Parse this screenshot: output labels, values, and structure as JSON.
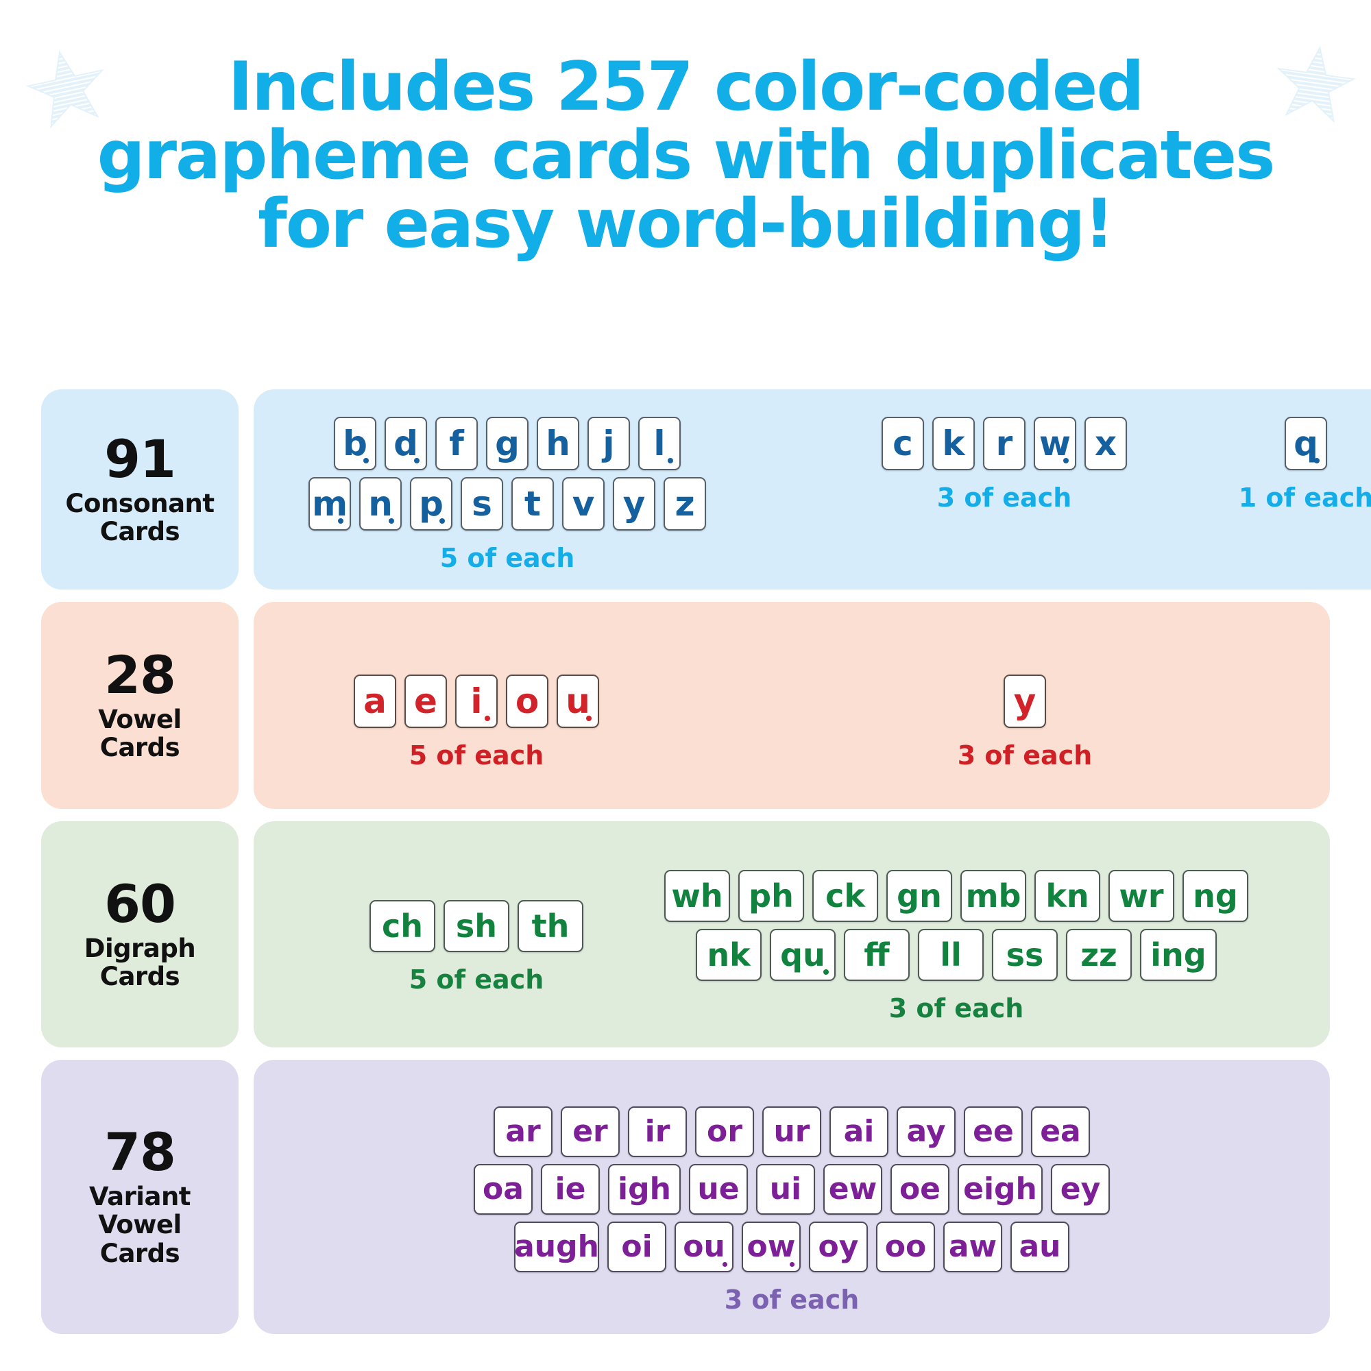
{
  "title": {
    "lines": [
      "Includes 257 color-coded",
      "grapheme cards with duplicates",
      "for easy word-building!"
    ],
    "color": "#11AEE8"
  },
  "decor": {
    "star_left": "star-icon",
    "star_right": "star-icon",
    "star_color": "#cde7f7"
  },
  "sections": [
    {
      "id": "consonant",
      "count": "91",
      "label_line1": "Consonant",
      "label_line2": "Cards",
      "panel_color": "#d6ecfa",
      "text_color": "#15609e",
      "count_label_color": "#15ade8",
      "groups": [
        {
          "id": "five",
          "count_label": "5 of each",
          "lines": [
            [
              {
                "t": "b",
                "dot": true
              },
              {
                "t": "d",
                "dot": true
              },
              {
                "t": "f",
                "dot": false
              },
              {
                "t": "g",
                "dot": false
              },
              {
                "t": "h",
                "dot": false
              },
              {
                "t": "j",
                "dot": false
              },
              {
                "t": "l",
                "dot": true
              }
            ],
            [
              {
                "t": "m",
                "dot": true
              },
              {
                "t": "n",
                "dot": true
              },
              {
                "t": "p",
                "dot": true
              },
              {
                "t": "s",
                "dot": false
              },
              {
                "t": "t",
                "dot": false
              },
              {
                "t": "v",
                "dot": false
              },
              {
                "t": "y",
                "dot": false
              },
              {
                "t": "z",
                "dot": false
              }
            ]
          ]
        },
        {
          "id": "three",
          "count_label": "3 of each",
          "lines": [
            [
              {
                "t": "c",
                "dot": false
              },
              {
                "t": "k",
                "dot": false
              },
              {
                "t": "r",
                "dot": false
              },
              {
                "t": "w",
                "dot": true
              },
              {
                "t": "x",
                "dot": false
              }
            ]
          ]
        },
        {
          "id": "one",
          "count_label": "1 of each",
          "lines": [
            [
              {
                "t": "q",
                "dot": true
              }
            ]
          ]
        }
      ]
    },
    {
      "id": "vowel",
      "count": "28",
      "label_line1": "Vowel",
      "label_line2": "Cards",
      "panel_color": "#fadfd2",
      "text_color": "#d2232a",
      "count_label_color": "#cf2026",
      "groups": [
        {
          "id": "five",
          "count_label": "5 of each",
          "lines": [
            [
              {
                "t": "a",
                "dot": false
              },
              {
                "t": "e",
                "dot": false
              },
              {
                "t": "i",
                "dot": true
              },
              {
                "t": "o",
                "dot": false
              },
              {
                "t": "u",
                "dot": true
              }
            ]
          ]
        },
        {
          "id": "three",
          "count_label": "3 of each",
          "lines": [
            [
              {
                "t": "y",
                "dot": false
              }
            ]
          ]
        }
      ]
    },
    {
      "id": "digraph",
      "count": "60",
      "label_line1": "Digraph",
      "label_line2": "Cards",
      "panel_color": "#dfebdb",
      "text_color": "#11833f",
      "count_label_color": "#17813f",
      "groups": [
        {
          "id": "five",
          "count_label": "5 of each",
          "lines": [
            [
              {
                "t": "ch",
                "dot": false
              },
              {
                "t": "sh",
                "dot": false
              },
              {
                "t": "th",
                "dot": false
              }
            ]
          ]
        },
        {
          "id": "three",
          "count_label": "3 of each",
          "lines": [
            [
              {
                "t": "wh",
                "dot": false
              },
              {
                "t": "ph",
                "dot": false
              },
              {
                "t": "ck",
                "dot": false
              },
              {
                "t": "gn",
                "dot": false
              },
              {
                "t": "mb",
                "dot": false
              },
              {
                "t": "kn",
                "dot": false
              },
              {
                "t": "wr",
                "dot": false
              },
              {
                "t": "ng",
                "dot": false
              }
            ],
            [
              {
                "t": "nk",
                "dot": false
              },
              {
                "t": "qu",
                "dot": true
              },
              {
                "t": "ff",
                "dot": false
              },
              {
                "t": "ll",
                "dot": false
              },
              {
                "t": "ss",
                "dot": false
              },
              {
                "t": "zz",
                "dot": false
              },
              {
                "t": "ing",
                "dot": false
              }
            ]
          ]
        }
      ]
    },
    {
      "id": "variant",
      "count": "78",
      "label_line1": "Variant",
      "label_line2": "Vowel",
      "label_line3": "Cards",
      "panel_color": "#e0dcef",
      "text_color": "#7d2097",
      "count_label_color": "#7a62b0",
      "groups": [
        {
          "id": "three",
          "count_label": "3 of each",
          "lines": [
            [
              {
                "t": "ar",
                "dot": false
              },
              {
                "t": "er",
                "dot": false
              },
              {
                "t": "ir",
                "dot": false
              },
              {
                "t": "or",
                "dot": false
              },
              {
                "t": "ur",
                "dot": false
              },
              {
                "t": "ai",
                "dot": false
              },
              {
                "t": "ay",
                "dot": false
              },
              {
                "t": "ee",
                "dot": false
              },
              {
                "t": "ea",
                "dot": false
              }
            ],
            [
              {
                "t": "oa",
                "dot": false
              },
              {
                "t": "ie",
                "dot": false
              },
              {
                "t": "igh",
                "dot": false
              },
              {
                "t": "ue",
                "dot": false
              },
              {
                "t": "ui",
                "dot": false
              },
              {
                "t": "ew",
                "dot": false
              },
              {
                "t": "oe",
                "dot": false
              },
              {
                "t": "eigh",
                "dot": false
              },
              {
                "t": "ey",
                "dot": false
              }
            ],
            [
              {
                "t": "augh",
                "dot": false
              },
              {
                "t": "oi",
                "dot": false
              },
              {
                "t": "ou",
                "dot": true
              },
              {
                "t": "ow",
                "dot": true
              },
              {
                "t": "oy",
                "dot": false
              },
              {
                "t": "oo",
                "dot": false
              },
              {
                "t": "aw",
                "dot": false
              },
              {
                "t": "au",
                "dot": false
              }
            ]
          ]
        }
      ]
    }
  ]
}
